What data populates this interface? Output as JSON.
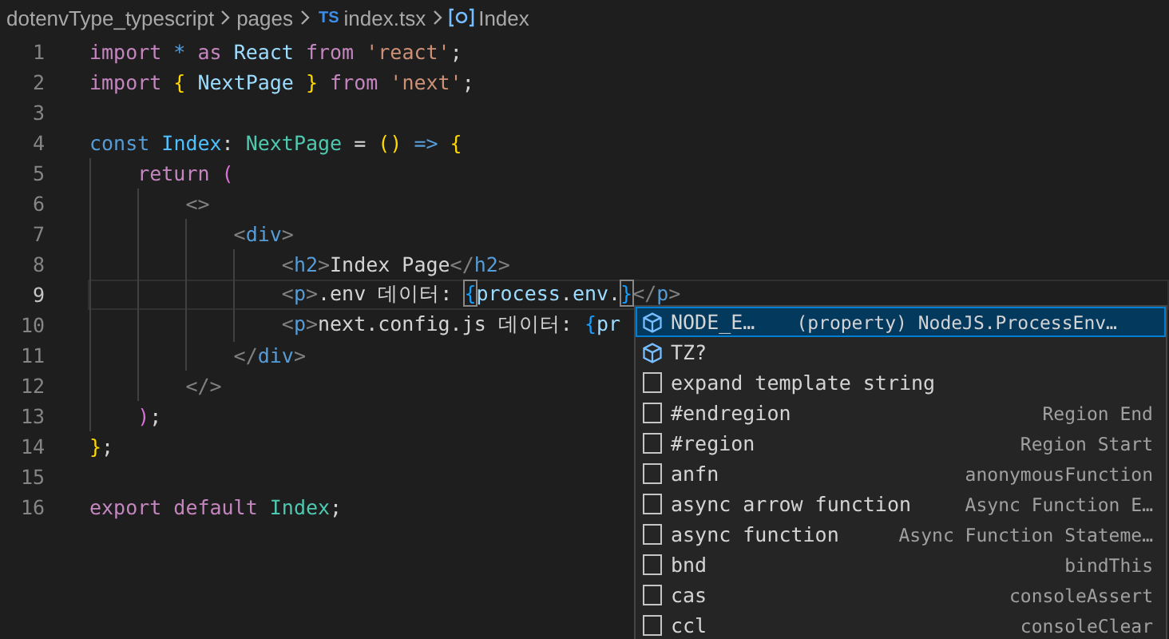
{
  "breadcrumb": [
    {
      "kind": "folder",
      "label": "dotenvType_typescript"
    },
    {
      "kind": "folder",
      "label": "pages"
    },
    {
      "kind": "file",
      "badge": "TS",
      "label": "index.tsx"
    },
    {
      "kind": "symbol",
      "label": "Index"
    }
  ],
  "editor": {
    "lines": [
      {
        "number": "1",
        "current": false,
        "tokens": [
          {
            "t": "import",
            "kind": "control"
          },
          {
            "t": " *",
            "kind": "keyword"
          },
          {
            "t": " as",
            "kind": "control"
          },
          {
            "t": " React",
            "kind": "variable"
          },
          {
            "t": " from",
            "kind": "control"
          },
          {
            "t": " 'react'",
            "kind": "string"
          },
          {
            "t": ";",
            "kind": "plain"
          }
        ]
      },
      {
        "number": "2",
        "current": false,
        "tokens": [
          {
            "t": "import",
            "kind": "control"
          },
          {
            "t": " {",
            "kind": "bracket1"
          },
          {
            "t": " NextPage",
            "kind": "variable"
          },
          {
            "t": " }",
            "kind": "bracket1"
          },
          {
            "t": " from",
            "kind": "control"
          },
          {
            "t": " 'next'",
            "kind": "string"
          },
          {
            "t": ";",
            "kind": "plain"
          }
        ]
      },
      {
        "number": "3",
        "current": false
      },
      {
        "number": "4",
        "current": false,
        "tokens": [
          {
            "t": "const",
            "kind": "keyword"
          },
          {
            "t": " Index",
            "kind": "constant"
          },
          {
            "t": ":",
            "kind": "plain"
          },
          {
            "t": " NextPage",
            "kind": "type"
          },
          {
            "t": " =",
            "kind": "plain"
          },
          {
            "t": " ()",
            "kind": "bracket1"
          },
          {
            "t": " =>",
            "kind": "keyword"
          },
          {
            "t": " {",
            "kind": "bracket1"
          }
        ]
      },
      {
        "number": "5",
        "current": false,
        "tokens": [
          {
            "t": "    return",
            "kind": "control"
          },
          {
            "t": " (",
            "kind": "bracket2"
          }
        ]
      },
      {
        "number": "6",
        "current": false,
        "tokens": [
          {
            "t": "        <>",
            "kind": "tagpunct"
          }
        ]
      },
      {
        "number": "7",
        "current": false,
        "tokens": [
          {
            "t": "            <",
            "kind": "tagpunct"
          },
          {
            "t": "div",
            "kind": "tag"
          },
          {
            "t": ">",
            "kind": "tagpunct"
          }
        ]
      },
      {
        "number": "8",
        "current": false,
        "tokens": [
          {
            "t": "                <",
            "kind": "tagpunct"
          },
          {
            "t": "h2",
            "kind": "tag"
          },
          {
            "t": ">",
            "kind": "tagpunct"
          },
          {
            "t": "Index Page",
            "kind": "plain"
          },
          {
            "t": "</",
            "kind": "tagpunct"
          },
          {
            "t": "h2",
            "kind": "tag"
          },
          {
            "t": ">",
            "kind": "tagpunct"
          }
        ]
      },
      {
        "number": "9",
        "current": true,
        "tokens": [
          {
            "t": "                <",
            "kind": "tagpunct"
          },
          {
            "t": "p",
            "kind": "tag"
          },
          {
            "t": ">",
            "kind": "tagpunct"
          },
          {
            "t": ".env 데이터: ",
            "kind": "plain"
          },
          {
            "t": "{",
            "kind": "match"
          },
          {
            "t": "process",
            "kind": "variable"
          },
          {
            "t": ".",
            "kind": "plain"
          },
          {
            "t": "env",
            "kind": "variable"
          },
          {
            "t": ".",
            "kind": "plain"
          },
          {
            "t": "}",
            "kind": "match"
          },
          {
            "t": "</",
            "kind": "tagpunct"
          },
          {
            "t": "p",
            "kind": "tag"
          },
          {
            "t": ">",
            "kind": "tagpunct"
          }
        ]
      },
      {
        "number": "10",
        "current": false,
        "tokens": [
          {
            "t": "                <",
            "kind": "tagpunct"
          },
          {
            "t": "p",
            "kind": "tag"
          },
          {
            "t": ">",
            "kind": "tagpunct"
          },
          {
            "t": "next.config.js 데이터: ",
            "kind": "plain"
          },
          {
            "t": "{",
            "kind": "bracket3"
          },
          {
            "t": "pr",
            "kind": "variable"
          }
        ]
      },
      {
        "number": "11",
        "current": false,
        "tokens": [
          {
            "t": "            </",
            "kind": "tagpunct"
          },
          {
            "t": "div",
            "kind": "tag"
          },
          {
            "t": ">",
            "kind": "tagpunct"
          }
        ]
      },
      {
        "number": "12",
        "current": false,
        "tokens": [
          {
            "t": "        </>",
            "kind": "tagpunct"
          }
        ]
      },
      {
        "number": "13",
        "current": false,
        "tokens": [
          {
            "t": "    )",
            "kind": "bracket2"
          },
          {
            "t": ";",
            "kind": "plain"
          }
        ]
      },
      {
        "number": "14",
        "current": false,
        "tokens": [
          {
            "t": "}",
            "kind": "bracket1"
          },
          {
            "t": ";",
            "kind": "plain"
          }
        ]
      },
      {
        "number": "15",
        "current": false
      },
      {
        "number": "16",
        "current": false,
        "tokens": [
          {
            "t": "export",
            "kind": "control"
          },
          {
            "t": " default",
            "kind": "control"
          },
          {
            "t": " Index",
            "kind": "type"
          },
          {
            "t": ";",
            "kind": "plain"
          }
        ]
      }
    ]
  },
  "suggestions": [
    {
      "kind": "property",
      "label": "NODE_E…",
      "detail": "(property) NodeJS.ProcessEnv…",
      "selected": true
    },
    {
      "kind": "property",
      "label": "TZ?",
      "selected": false
    },
    {
      "kind": "snippet",
      "label": "expand template string",
      "selected": false
    },
    {
      "kind": "snippet",
      "label": "#endregion",
      "detail": "Region End",
      "selected": false
    },
    {
      "kind": "snippet",
      "label": "#region",
      "detail": "Region Start",
      "selected": false
    },
    {
      "kind": "snippet",
      "label": "anfn",
      "detail": "anonymousFunction",
      "selected": false
    },
    {
      "kind": "snippet",
      "label": "async arrow function",
      "detail": "Async Function E…",
      "selected": false
    },
    {
      "kind": "snippet",
      "label": "async function",
      "detail": "Async Function Stateme…",
      "selected": false
    },
    {
      "kind": "snippet",
      "label": "bnd",
      "detail": "bindThis",
      "selected": false
    },
    {
      "kind": "snippet",
      "label": "cas",
      "detail": "consoleAssert",
      "selected": false
    },
    {
      "kind": "snippet",
      "label": "ccl",
      "detail": "consoleClear",
      "selected": false
    }
  ]
}
